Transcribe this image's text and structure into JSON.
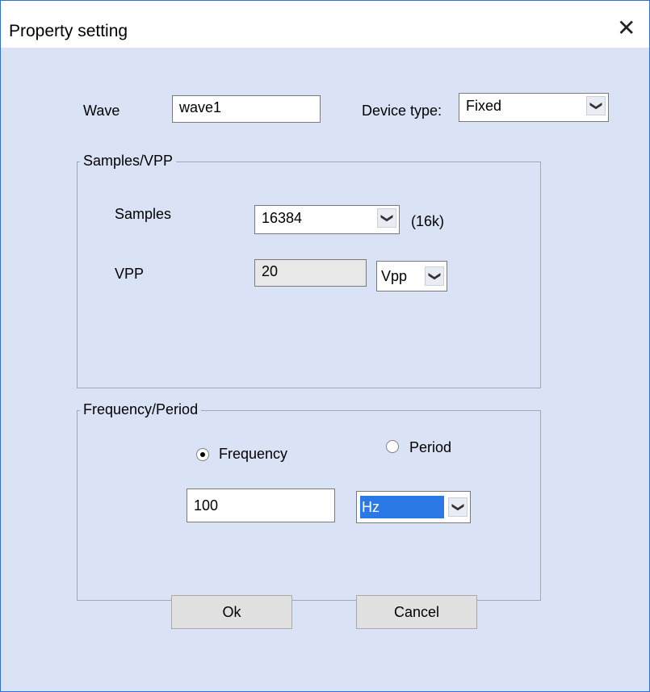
{
  "window": {
    "title": "Property setting"
  },
  "wave": {
    "label": "Wave",
    "value": "wave1"
  },
  "device_type": {
    "label": "Device type:",
    "selected": "Fixed"
  },
  "samples_vpp": {
    "legend": "Samples/VPP",
    "samples_label": "Samples",
    "samples_selected": "16384",
    "samples_hint": "(16k)",
    "vpp_label": "VPP",
    "vpp_value": "20",
    "vpp_unit": "Vpp"
  },
  "freq_period": {
    "legend": "Frequency/Period",
    "frequency_label": "Frequency",
    "period_label": "Period",
    "selected_mode": "Frequency",
    "value": "100",
    "unit": "Hz"
  },
  "buttons": {
    "ok": "Ok",
    "cancel": "Cancel"
  },
  "icons": {
    "close": "close-icon",
    "dropdown": "chevron-down-icon"
  },
  "colors": {
    "dialog_bg": "#d9e3f5",
    "selection": "#2b79e6",
    "border_accent": "#2f6fd6"
  }
}
